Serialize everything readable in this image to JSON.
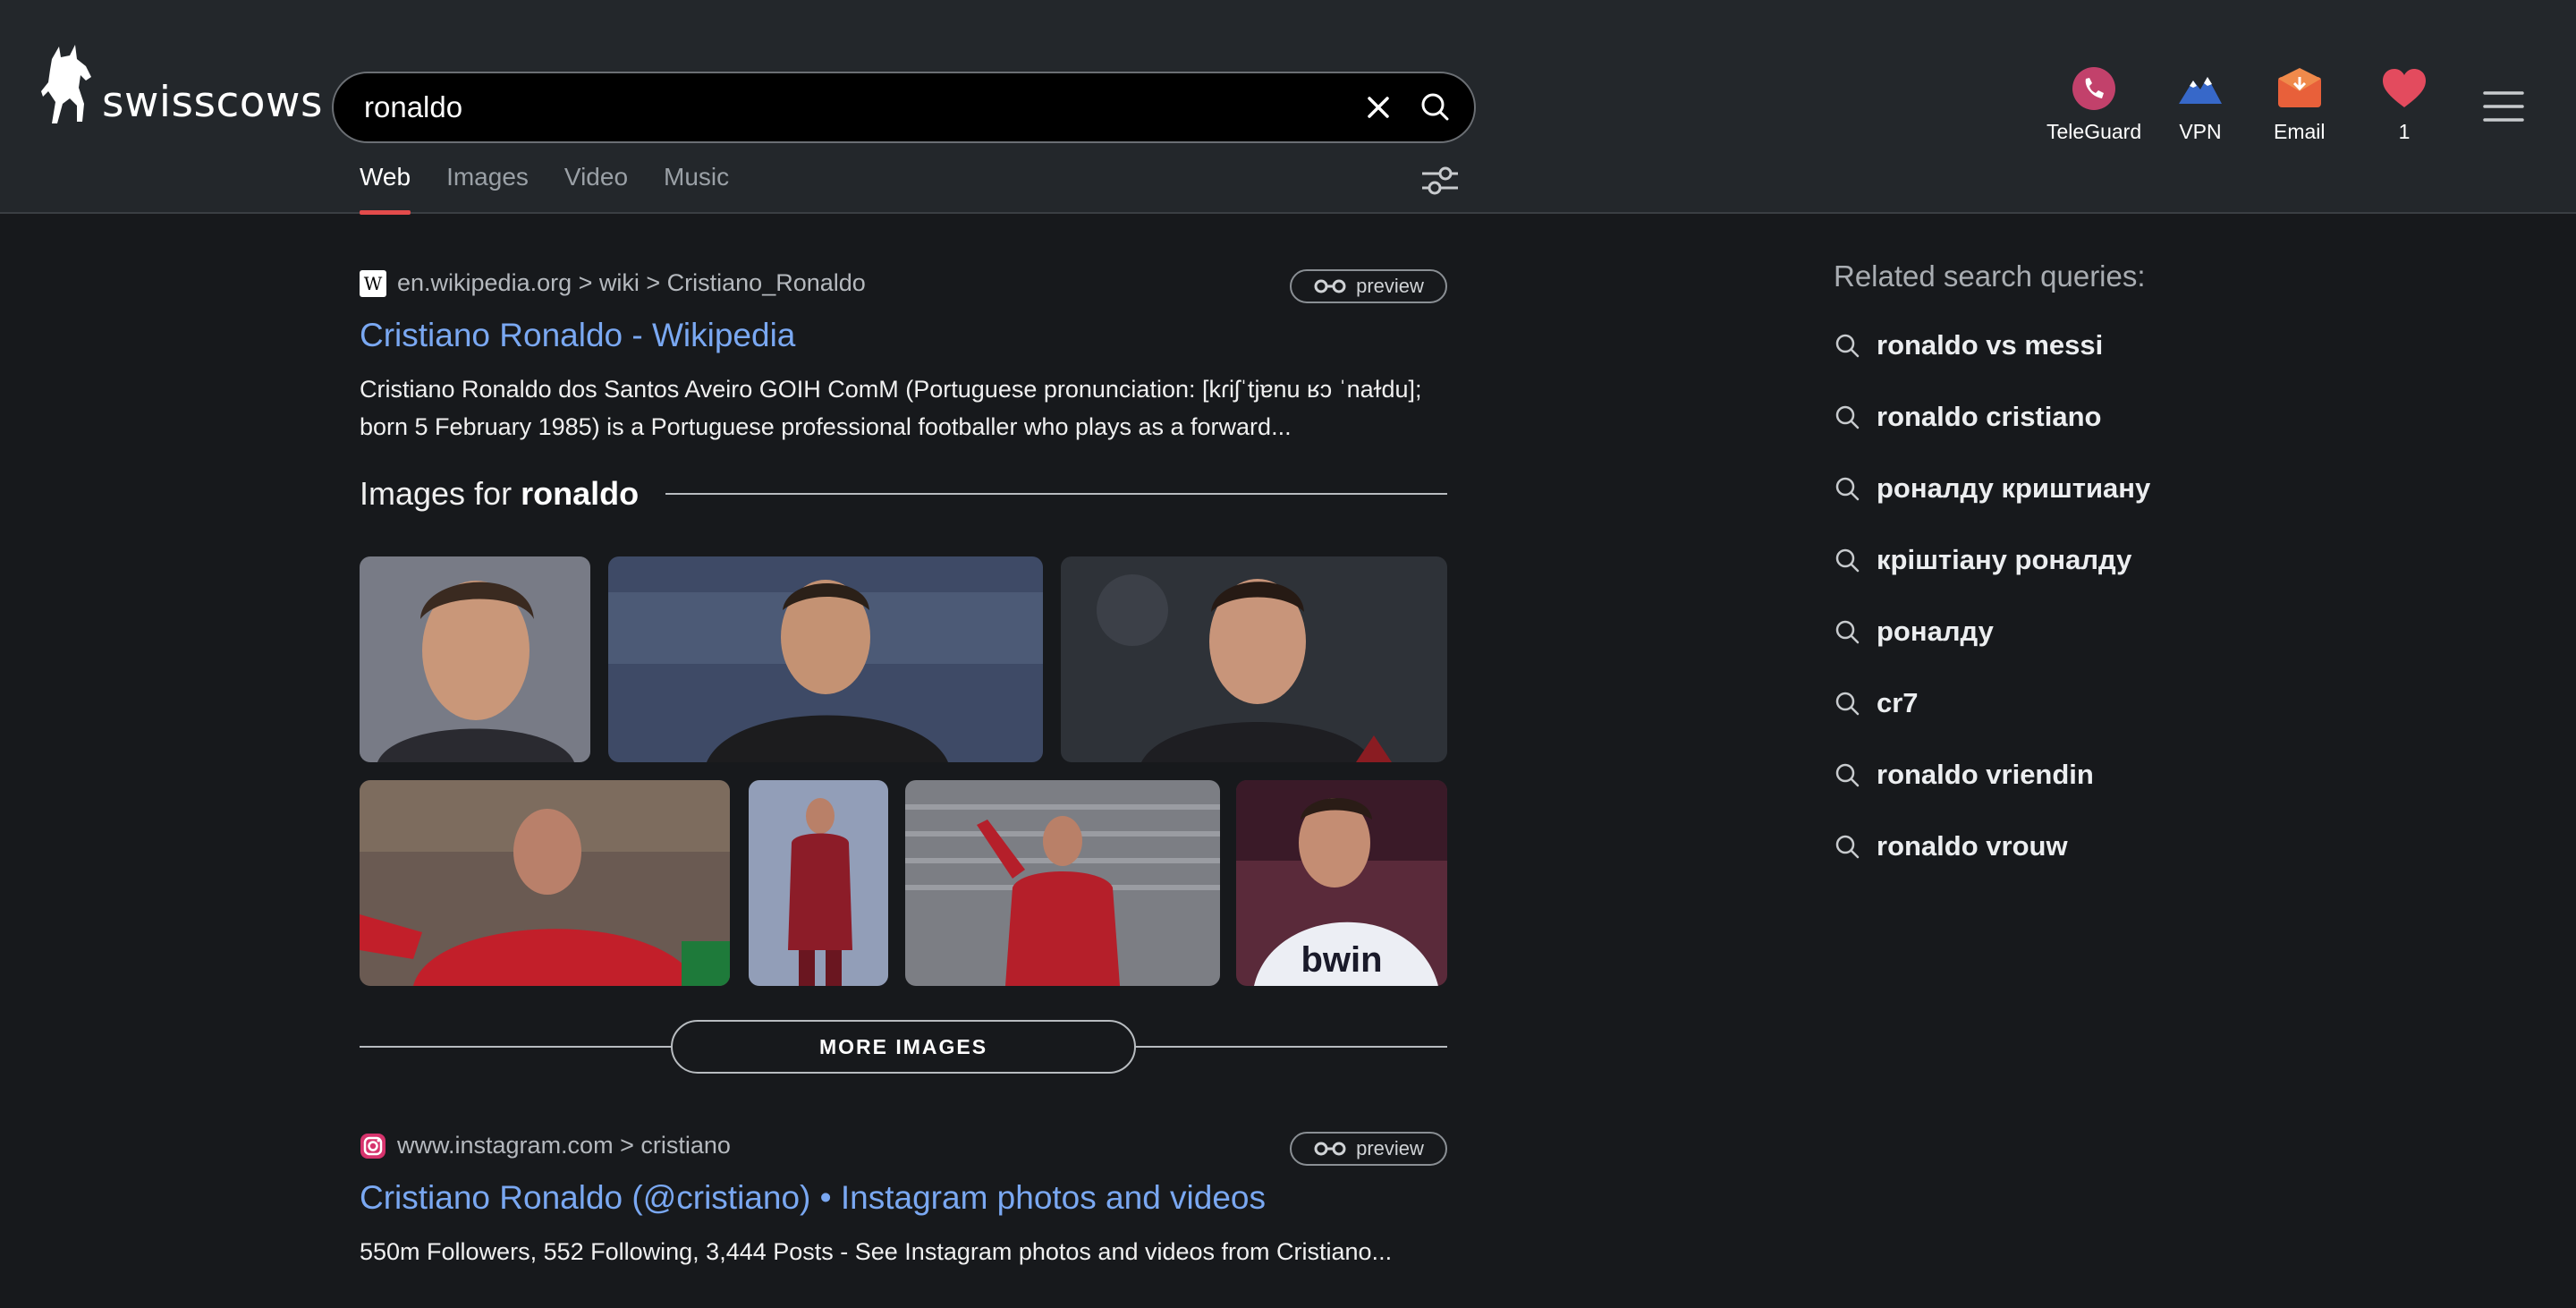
{
  "header": {
    "logo_text": "swisscows",
    "search": {
      "value": "ronaldo",
      "placeholder": ""
    },
    "tabs": [
      {
        "label": "Web",
        "active": true
      },
      {
        "label": "Images",
        "active": false
      },
      {
        "label": "Video",
        "active": false
      },
      {
        "label": "Music",
        "active": false
      }
    ],
    "right_items": [
      {
        "label": "TeleGuard",
        "icon": "teleguard-icon"
      },
      {
        "label": "VPN",
        "icon": "vpn-mountain-icon"
      },
      {
        "label": "Email",
        "icon": "email-envelope-icon"
      },
      {
        "label": "1",
        "icon": "heart-icon"
      }
    ]
  },
  "results": [
    {
      "breadcrumb": "en.wikipedia.org > wiki > Cristiano_Ronaldo",
      "favicon": "wikipedia-icon",
      "preview_label": "preview",
      "title": "Cristiano Ronaldo - Wikipedia",
      "snippet": "Cristiano Ronaldo dos Santos Aveiro GOIH ComM (Portuguese pronunciation: [kɾiʃˈtjɐnu ʁɔ ˈnaɫdu]; born 5 February 1985) is a Portuguese professional footballer who plays as a forward..."
    },
    {
      "breadcrumb": "www.instagram.com > cristiano",
      "favicon": "instagram-icon",
      "preview_label": "preview",
      "title": "Cristiano Ronaldo (@cristiano) • Instagram photos and videos",
      "snippet": "550m Followers, 552 Following, 3,444 Posts - See Instagram photos and videos from Cristiano..."
    }
  ],
  "images_block": {
    "prefix": "Images for ",
    "query": "ronaldo",
    "more_label": "MORE IMAGES"
  },
  "related": {
    "heading": "Related search queries:",
    "items": [
      "ronaldo vs messi",
      "ronaldo cristiano",
      "роналду криштиану",
      "кріштіану роналду",
      "роналду",
      "cr7",
      "ronaldo vriendin",
      "ronaldo vrouw"
    ]
  },
  "colors": {
    "header_bg": "#23272b",
    "page_bg": "#17191c",
    "link": "#7aa8f2",
    "accent": "#e34b4b"
  }
}
